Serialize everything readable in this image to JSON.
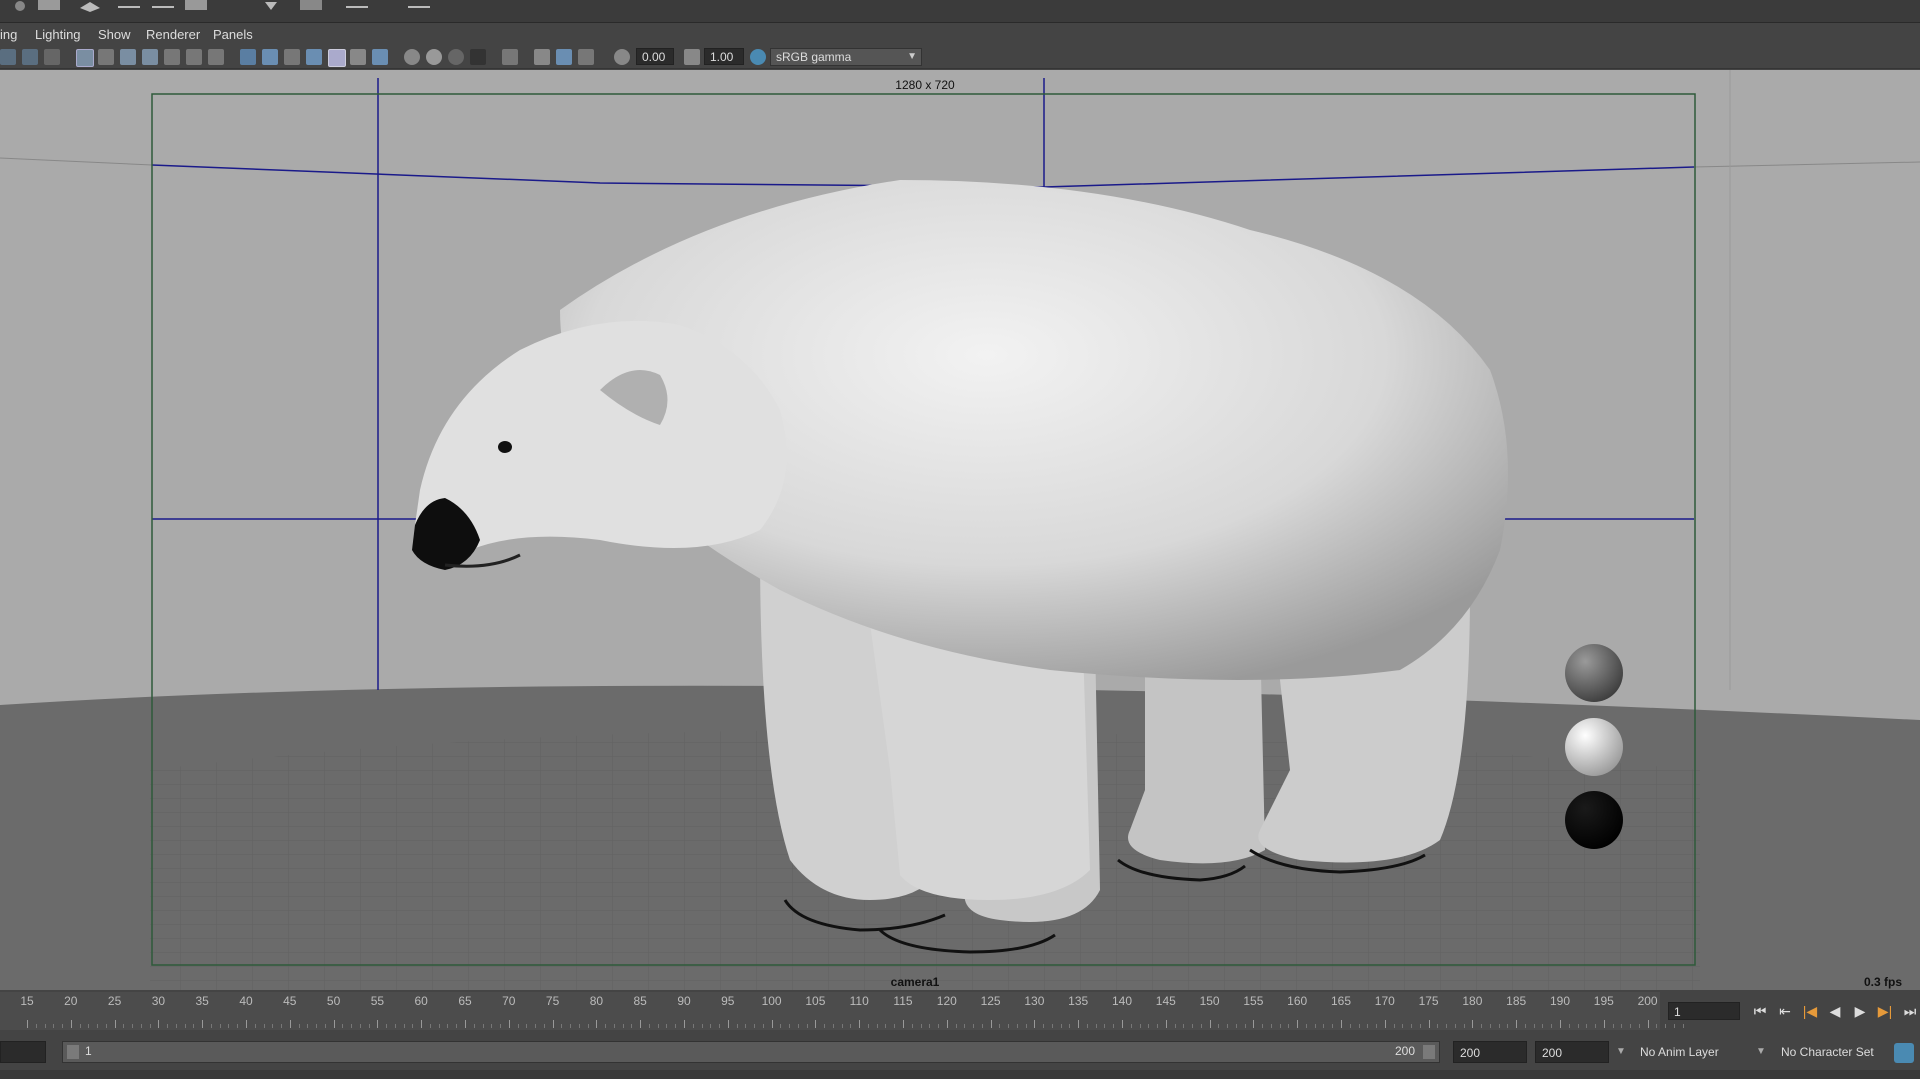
{
  "menubar": {
    "items": [
      "ing",
      "Lighting",
      "Show",
      "Renderer",
      "Panels"
    ]
  },
  "toolbar": {
    "exposure_value": "0.00",
    "gamma_value": "1.00",
    "color_space": "sRGB gamma"
  },
  "viewport": {
    "resolution_gate_label": "1280 x 720",
    "camera_label": "camera1",
    "fps_label": "0.3 fps"
  },
  "timeline": {
    "tick_labels": [
      "15",
      "20",
      "25",
      "30",
      "35",
      "40",
      "45",
      "50",
      "55",
      "60",
      "65",
      "70",
      "75",
      "80",
      "85",
      "90",
      "95",
      "100",
      "105",
      "110",
      "115",
      "120",
      "125",
      "130",
      "135",
      "140",
      "145",
      "150",
      "155",
      "160",
      "165",
      "170",
      "175",
      "180",
      "185",
      "190",
      "195",
      "200"
    ],
    "current_frame": "1"
  },
  "range": {
    "start_field": "",
    "slider_start_label": "1",
    "slider_end_label": "200",
    "anim_end": "200",
    "playback_end": "200",
    "anim_layer": "No Anim Layer",
    "character_set": "No Character Set"
  },
  "colors": {
    "viewport_bg": "#a9a9a9",
    "gate_border": "#2e5a3a",
    "grid_line": "#1a1a8a",
    "floor": "#6b6b6b"
  }
}
